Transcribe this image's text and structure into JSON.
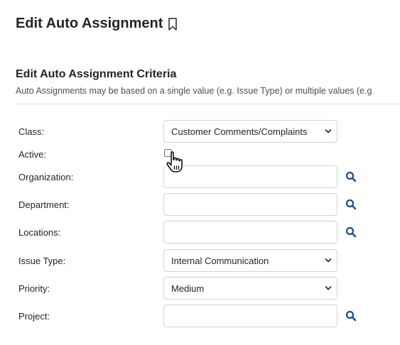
{
  "page": {
    "title": "Edit Auto Assignment"
  },
  "section": {
    "title": "Edit Auto Assignment Criteria",
    "description": "Auto Assignments may be based on a single value (e.g. Issue Type) or multiple values (e.g"
  },
  "form": {
    "class": {
      "label": "Class:",
      "value": "Customer Comments/Complaints"
    },
    "active": {
      "label": "Active:",
      "checked": false
    },
    "organization": {
      "label": "Organization:",
      "value": ""
    },
    "department": {
      "label": "Department:",
      "value": ""
    },
    "locations": {
      "label": "Locations:",
      "value": ""
    },
    "issue_type": {
      "label": "Issue Type:",
      "value": "Internal Communication"
    },
    "priority": {
      "label": "Priority:",
      "value": "Medium"
    },
    "project": {
      "label": "Project:",
      "value": ""
    }
  },
  "icons": {
    "title_icon": "bookmark-icon",
    "lookup_icon": "search-icon",
    "select_icon": "chevron-down-icon",
    "cursor": "hand-cursor-icon"
  },
  "colors": {
    "lookup_icon": "#1f4e8c",
    "border": "#ced4da",
    "text": "#212529"
  }
}
